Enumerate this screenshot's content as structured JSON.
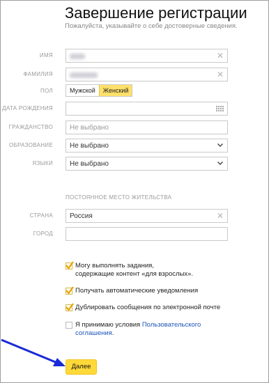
{
  "header": {
    "title": "Завершение регистрации",
    "subtitle": "Пожалуйста, указывайте о себе достоверные сведения."
  },
  "form": {
    "name": {
      "label": "ИМЯ"
    },
    "surname": {
      "label": "ФАМИЛИЯ"
    },
    "gender": {
      "label": "ПОЛ",
      "options": [
        "Мужской",
        "Женский"
      ],
      "selected": "Женский"
    },
    "birthdate": {
      "label": "ДАТА РОЖДЕНИЯ"
    },
    "citizenship": {
      "label": "ГРАЖДАНСТВО",
      "placeholder": "Не выбрано"
    },
    "education": {
      "label": "ОБРАЗОВАНИЕ",
      "value": "Не выбрано"
    },
    "languages": {
      "label": "ЯЗЫКИ",
      "value": "Не выбрано"
    },
    "residence_heading": "ПОСТОЯННОЕ МЕСТО ЖИТЕЛЬСТВА",
    "country": {
      "label": "СТРАНА",
      "value": "Россия"
    },
    "city": {
      "label": "ГОРОД"
    }
  },
  "checks": {
    "adult": {
      "line1": "Могу выполнять задания,",
      "line2": "содержащие контент «для взрослых».",
      "checked": true
    },
    "notifications": {
      "text": "Получать автоматические уведомления",
      "checked": true
    },
    "email_dup": {
      "text": "Дублировать сообщения по электронной почте",
      "checked": true
    },
    "terms": {
      "prefix": "Я принимаю условия ",
      "link1": "Пользовательского",
      "link2": "соглашения",
      "suffix": ".",
      "checked": false
    }
  },
  "actions": {
    "next_label": "Далее"
  },
  "colors": {
    "accent": "#ffd83a",
    "link": "#1d54b8",
    "arrow": "#1a2ad6",
    "check": "#e6a400"
  }
}
